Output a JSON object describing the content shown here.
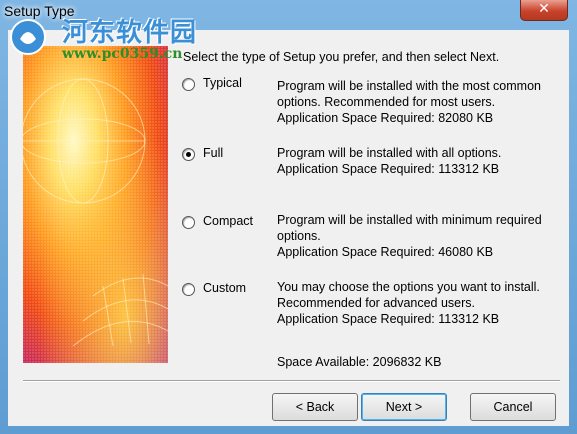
{
  "window": {
    "title": "Setup Type",
    "close_glyph": "✕"
  },
  "watermark": {
    "site_name": "河东软件园",
    "url": "www.pc0359.cn"
  },
  "intro": "Select the type of Setup you prefer, and then select Next.",
  "options": [
    {
      "label": "Typical",
      "checked": false,
      "desc_lines": [
        "Program will be installed with the most common",
        "options.  Recommended for most users.",
        "Application Space Required: 82080 KB"
      ]
    },
    {
      "label": "Full",
      "checked": true,
      "desc_lines": [
        "Program will be installed with all options.",
        "Application Space Required: 113312 KB"
      ]
    },
    {
      "label": "Compact",
      "checked": false,
      "desc_lines": [
        "Program will be installed with minimum required",
        "options.",
        "Application Space Required: 46080 KB"
      ]
    },
    {
      "label": "Custom",
      "checked": false,
      "desc_lines": [
        "You may choose the options you want to install.",
        "Recommended for advanced users.",
        "Application Space Required: 113312 KB"
      ]
    }
  ],
  "space_available": "Space Available: 2096832 KB",
  "buttons": {
    "back": "< Back",
    "next": "Next >",
    "cancel": "Cancel"
  },
  "colors": {
    "title_bar": "#6aa6d6",
    "close_button": "#c8432c",
    "dialog_bg": "#f0f0f0",
    "default_button_border": "#3c7fb1"
  }
}
